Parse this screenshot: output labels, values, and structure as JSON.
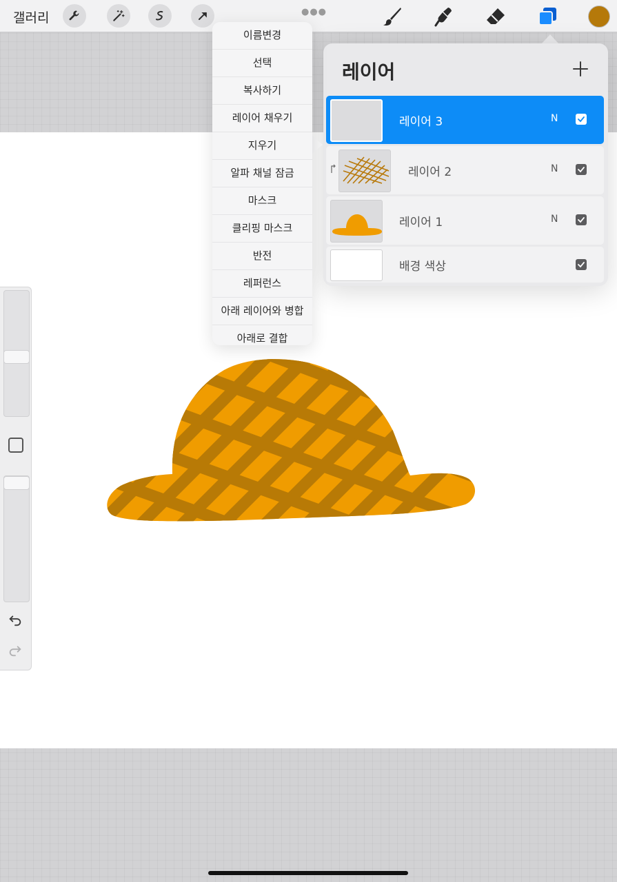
{
  "toolbar": {
    "gallery_label": "갤러리",
    "tools_left": [
      {
        "icon": "wrench-icon"
      },
      {
        "icon": "magic-wand-icon"
      },
      {
        "icon": "selection-icon"
      },
      {
        "icon": "transform-arrow-icon"
      }
    ],
    "tools_right": [
      {
        "icon": "brush-icon"
      },
      {
        "icon": "smudge-icon"
      },
      {
        "icon": "eraser-icon"
      },
      {
        "icon": "layers-icon"
      }
    ],
    "active_tool": "layers-icon",
    "current_color": "#b5790a",
    "accent_color": "#0d8cf7"
  },
  "context_menu": {
    "items": [
      "이름변경",
      "선택",
      "복사하기",
      "레이어 채우기",
      "지우기",
      "알파 채널 잠금",
      "마스크",
      "클리핑 마스크",
      "반전",
      "레퍼런스",
      "아래 레이어와 병합",
      "아래로 결합"
    ]
  },
  "layers_panel": {
    "title": "레이어",
    "add_icon": "plus-icon",
    "layers": [
      {
        "name": "레이어 3",
        "blend": "N",
        "visible": true,
        "selected": true
      },
      {
        "name": "레이어 2",
        "blend": "N",
        "visible": true,
        "clipping": true
      },
      {
        "name": "레이어 1",
        "blend": "N",
        "visible": true
      },
      {
        "name": "배경 색상",
        "visible": true
      }
    ]
  },
  "sidebar": {
    "brush_size_level": 0.2,
    "opacity_level": 0.0,
    "icons": [
      "modifier-square-icon",
      "undo-icon",
      "redo-icon"
    ]
  },
  "canvas": {
    "hat_fill": "#f09c00",
    "weave_color": "#b87a06"
  }
}
